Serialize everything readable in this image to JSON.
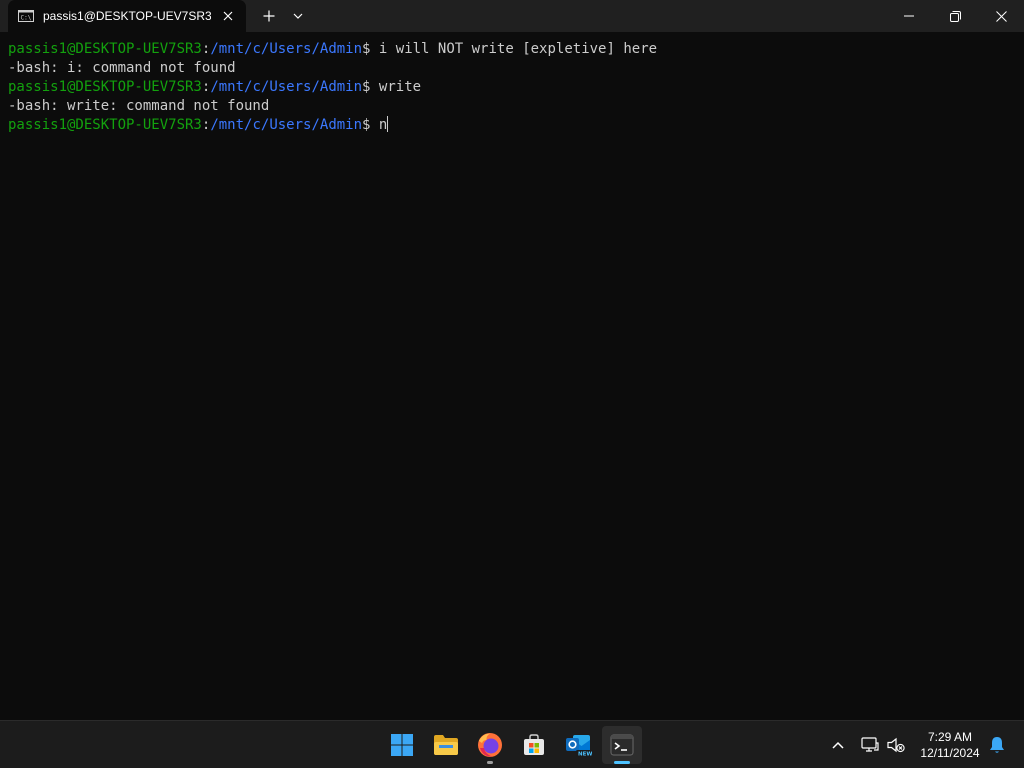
{
  "window": {
    "tab_title": "passis1@DESKTOP-UEV7SR3: ,",
    "tab_icon": "terminal-icon",
    "new_tab_icon": "plus-icon",
    "dropdown_icon": "chevron-down-icon",
    "controls": [
      "minimize-icon",
      "maximize-icon",
      "close-icon"
    ]
  },
  "terminal": {
    "prompt": {
      "user_host": "passis1@DESKTOP-UEV7SR3",
      "colon": ":",
      "path": "/mnt/c/Users/Admin",
      "dollar": "$"
    },
    "lines": [
      {
        "type": "prompt",
        "command": "i will NOT write [expletive] here"
      },
      {
        "type": "output",
        "text": "-bash: i: command not found"
      },
      {
        "type": "prompt",
        "command": "write"
      },
      {
        "type": "output",
        "text": "-bash: write: command not found"
      },
      {
        "type": "prompt",
        "command": "n"
      }
    ],
    "colors": {
      "user": "#13a10e",
      "path": "#3b78ff",
      "text": "#cccccc",
      "background": "#0c0c0c"
    }
  },
  "taskbar": {
    "apps": [
      {
        "name": "start-icon",
        "state": "none"
      },
      {
        "name": "file-explorer-icon",
        "state": "none"
      },
      {
        "name": "firefox-icon",
        "state": "open"
      },
      {
        "name": "microsoft-store-icon",
        "state": "none"
      },
      {
        "name": "outlook-icon",
        "state": "none",
        "badge": "NEW"
      },
      {
        "name": "terminal-icon",
        "state": "focused"
      }
    ],
    "tray_icons": [
      "chevron-up-icon",
      "display-icon",
      "sound-muted-icon",
      "bell-icon"
    ],
    "clock": {
      "time": "7:29 AM",
      "date": "12/11/2024"
    },
    "accent": "#4cc2ff"
  }
}
